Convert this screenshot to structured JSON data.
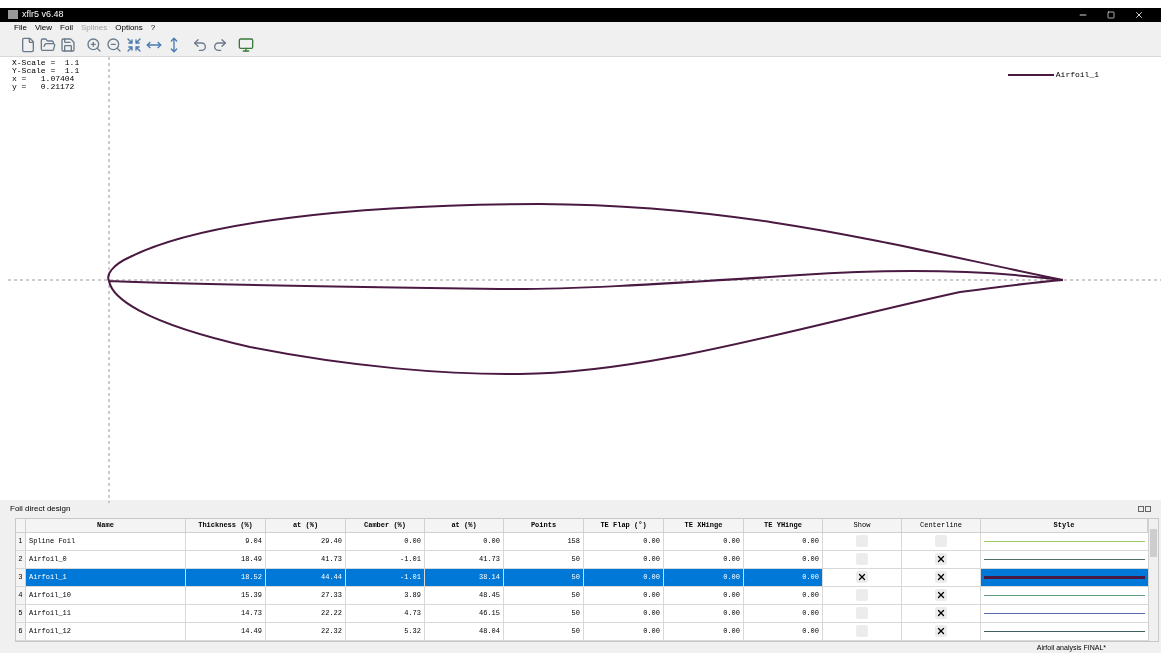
{
  "window": {
    "title": "xflr5 v6.48"
  },
  "menu": [
    {
      "label": "File",
      "disabled": false
    },
    {
      "label": "View",
      "disabled": false
    },
    {
      "label": "Foil",
      "disabled": false
    },
    {
      "label": "Splines",
      "disabled": true
    },
    {
      "label": "Options",
      "disabled": false
    },
    {
      "label": "?",
      "disabled": false
    }
  ],
  "canvas": {
    "info": [
      "X-Scale =  1.1",
      "Y-Scale =  1.1",
      "x =   1.07404",
      "y =   0.21172"
    ],
    "legend": {
      "label": "Airfoil_1",
      "color": "#4a1942"
    }
  },
  "panel": {
    "title": "Foil direct design",
    "table": {
      "columns": [
        "Name",
        "Thickness (%)",
        "at (%)",
        "Camber (%)",
        "at (%)",
        "Points",
        "TE Flap (°)",
        "TE XHinge",
        "TE YHinge",
        "Show",
        "Centerline",
        "Style"
      ],
      "rows": [
        {
          "index": "1",
          "name": "Spline Foil",
          "cells": [
            "9.04",
            "29.40",
            "0.00",
            "0.00",
            "158",
            "0.00",
            "0.00",
            "0.00"
          ],
          "show": false,
          "centerline": false,
          "color": "#9ccc65",
          "selected": false
        },
        {
          "index": "2",
          "name": "Airfoil_0",
          "cells": [
            "18.49",
            "41.73",
            "-1.01",
            "41.73",
            "50",
            "0.00",
            "0.00",
            "0.00"
          ],
          "show": false,
          "centerline": true,
          "color": "#4f6f5f",
          "selected": false
        },
        {
          "index": "3",
          "name": "Airfoil_1",
          "cells": [
            "18.52",
            "44.44",
            "-1.01",
            "38.14",
            "50",
            "0.00",
            "0.00",
            "0.00"
          ],
          "show": true,
          "centerline": true,
          "color": "#4a1942",
          "selected": true
        },
        {
          "index": "4",
          "name": "Airfoil_10",
          "cells": [
            "15.39",
            "27.33",
            "3.89",
            "48.45",
            "50",
            "0.00",
            "0.00",
            "0.00"
          ],
          "show": false,
          "centerline": true,
          "color": "#5f9f80",
          "selected": false
        },
        {
          "index": "5",
          "name": "Airfoil_11",
          "cells": [
            "14.73",
            "22.22",
            "4.73",
            "46.15",
            "50",
            "0.00",
            "0.00",
            "0.00"
          ],
          "show": false,
          "centerline": true,
          "color": "#5a6ab0",
          "selected": false
        },
        {
          "index": "6",
          "name": "Airfoil_12",
          "cells": [
            "14.49",
            "22.32",
            "5.32",
            "48.04",
            "50",
            "0.00",
            "0.00",
            "0.00"
          ],
          "show": false,
          "centerline": true,
          "color": "#3f5f5f",
          "selected": false
        }
      ]
    }
  },
  "status_bar": {
    "text": "Airfoil analysis FINAL*"
  }
}
